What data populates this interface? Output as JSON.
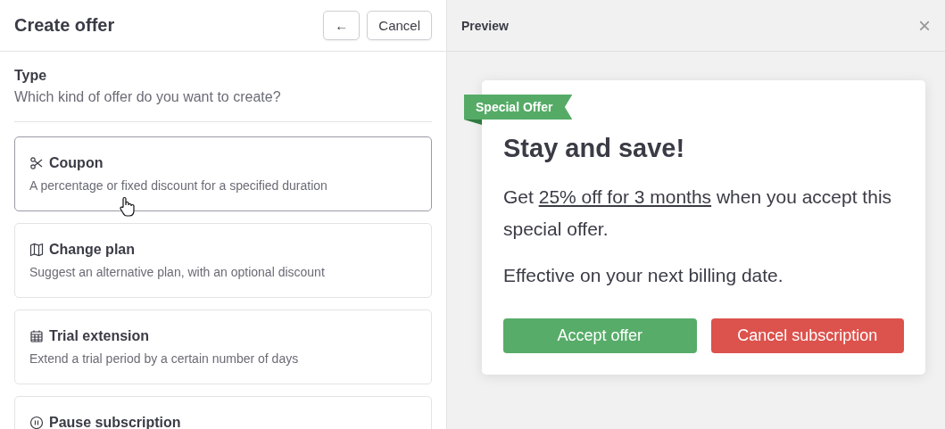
{
  "editor": {
    "title": "Create offer",
    "back_button": "←",
    "cancel_button": "Cancel",
    "section": {
      "label": "Type",
      "hint": "Which kind of offer do you want to create?"
    },
    "options": [
      {
        "kind": "coupon",
        "title": "Coupon",
        "description": "A percentage or fixed discount for a specified duration",
        "selected": true
      },
      {
        "kind": "plan",
        "title": "Change plan",
        "description": "Suggest an alternative plan, with an optional discount",
        "selected": false
      },
      {
        "kind": "trial",
        "title": "Trial extension",
        "description": "Extend a trial period by a certain number of days",
        "selected": false
      },
      {
        "kind": "pause",
        "title": "Pause subscription",
        "selected": false
      }
    ]
  },
  "preview": {
    "title": "Preview",
    "close": "×",
    "ribbon": "Special Offer",
    "heading": "Stay and save!",
    "body_before": "Get",
    "body_highlight": "25% off for 3 months",
    "body_after": "when you accept this special offer.",
    "note": "Effective on your next billing date.",
    "accept_button": "Accept offer",
    "decline_button": "Cancel subscription"
  }
}
